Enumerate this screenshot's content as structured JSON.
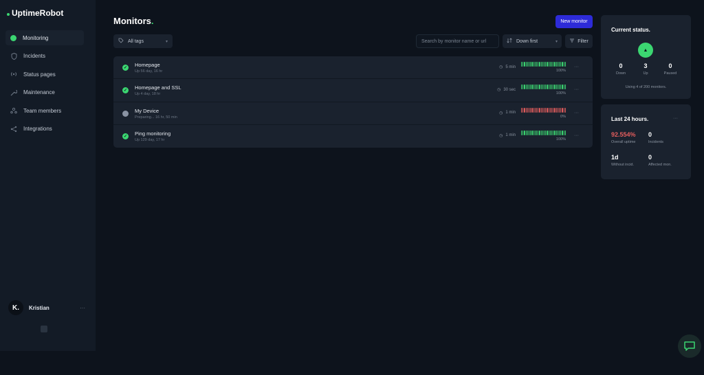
{
  "brand": {
    "name": "UptimeRobot"
  },
  "sidebar": {
    "items": [
      {
        "label": "Monitoring",
        "icon": "monitoring-dot-icon",
        "active": true
      },
      {
        "label": "Incidents",
        "icon": "shield-icon",
        "active": false
      },
      {
        "label": "Status pages",
        "icon": "broadcast-icon",
        "active": false
      },
      {
        "label": "Maintenance",
        "icon": "wrench-icon",
        "active": false
      },
      {
        "label": "Team members",
        "icon": "team-icon",
        "active": false
      },
      {
        "label": "Integrations",
        "icon": "share-icon",
        "active": false
      }
    ],
    "user": {
      "initial": "K.",
      "name": "Kristian",
      "more": "···"
    }
  },
  "header": {
    "title": "Monitors",
    "title_dot": ".",
    "new_monitor_label": "New monitor"
  },
  "toolbar": {
    "tags_label": "All tags",
    "search_placeholder": "Search by monitor name or url",
    "sort_label": "Down first",
    "filter_label": "Filter"
  },
  "monitors": [
    {
      "name": "Homepage",
      "sub": "Up 56 day, 16 hr",
      "interval": "5 min",
      "uptime": "100%",
      "state": "up"
    },
    {
      "name": "Homepage and SSL",
      "sub": "Up 4 day, 18 hr",
      "interval": "30 sec",
      "uptime": "100%",
      "state": "up"
    },
    {
      "name": "My Device",
      "sub": "Preparing... 16 hr, 50 min",
      "interval": "1 min",
      "uptime": "0%",
      "state": "down"
    },
    {
      "name": "Ping monitoring",
      "sub": "Up 129 day, 17 hr",
      "interval": "1 min",
      "uptime": "100%",
      "state": "up"
    }
  ],
  "current_status": {
    "title": "Current status.",
    "down": {
      "value": "0",
      "label": "Down"
    },
    "up": {
      "value": "3",
      "label": "Up"
    },
    "paused": {
      "value": "0",
      "label": "Paused"
    },
    "note": "Using 4 of 200 monitors."
  },
  "last_24": {
    "title": "Last 24 hours.",
    "uptime": {
      "value": "92.554%",
      "label": "Overall uptime"
    },
    "incidents": {
      "value": "0",
      "label": "Incidents"
    },
    "without": {
      "value": "1d",
      "label": "Without incid."
    },
    "affected": {
      "value": "0",
      "label": "Affected mon."
    }
  },
  "colors": {
    "accent_green": "#3bd671",
    "accent_red": "#e35d5d",
    "paused_gray": "#8a93a3",
    "primary_button": "#2d2bd8"
  }
}
